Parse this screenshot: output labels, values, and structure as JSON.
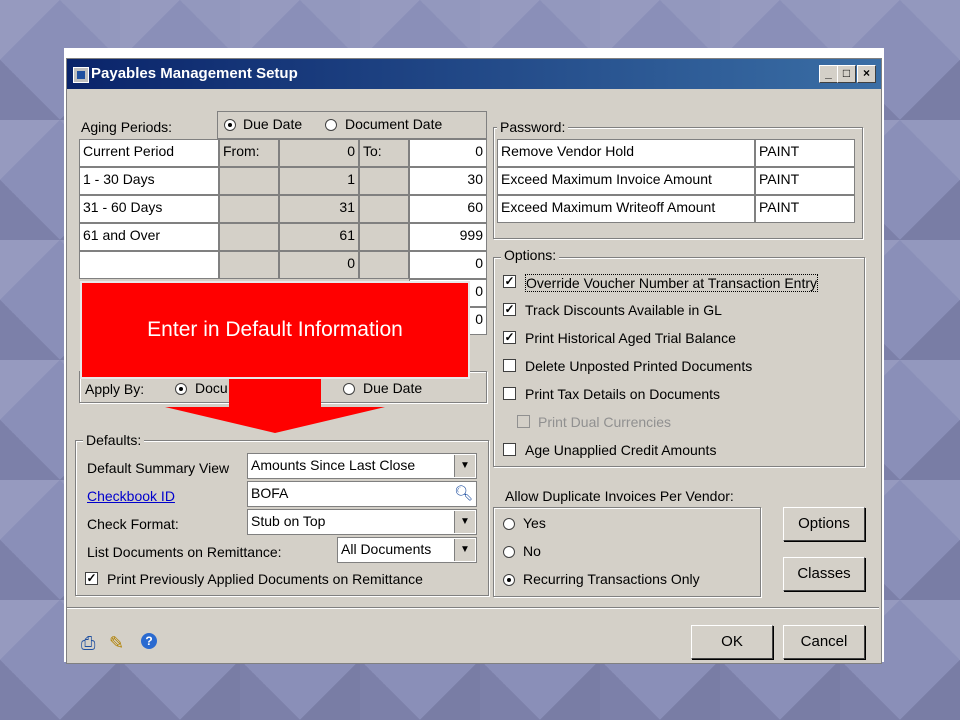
{
  "window": {
    "title": "Payables Management Setup"
  },
  "aging": {
    "label": "Aging Periods:",
    "radio_due_date": "Due Date",
    "radio_document_date": "Document Date",
    "from_label": "From:",
    "to_label": "To:",
    "rows": [
      {
        "name": "Current Period",
        "from": "0",
        "to": "0"
      },
      {
        "name": "1 - 30 Days",
        "from": "1",
        "to": "30"
      },
      {
        "name": "31 - 60 Days",
        "from": "31",
        "to": "60"
      },
      {
        "name": "61 and Over",
        "from": "61",
        "to": "999"
      },
      {
        "name": "",
        "from": "0",
        "to": "0"
      },
      {
        "name": "",
        "from": "",
        "to": "0"
      },
      {
        "name": "",
        "from": "",
        "to": "0"
      }
    ],
    "apply_by_label": "Apply By:",
    "apply_by_doc": "Docu",
    "apply_by_due": "Due Date"
  },
  "callout": {
    "text": "Enter in Default Information"
  },
  "password": {
    "title": "Password:",
    "rows": [
      {
        "label": "Remove Vendor Hold",
        "value": "PAINT"
      },
      {
        "label": "Exceed Maximum Invoice Amount",
        "value": "PAINT"
      },
      {
        "label": "Exceed Maximum Writeoff Amount",
        "value": "PAINT"
      }
    ]
  },
  "options": {
    "title": "Options:",
    "items": [
      {
        "label": "Override Voucher Number at Transaction Entry",
        "checked": true
      },
      {
        "label": "Track Discounts  Available in GL",
        "checked": true
      },
      {
        "label": "Print Historical  Aged Trial Balance",
        "checked": true
      },
      {
        "label": "Delete Unposted Printed Documents",
        "checked": false
      },
      {
        "label": "Print Tax Details on Documents",
        "checked": false
      },
      {
        "label": "Print Dual Currencies",
        "checked": false
      },
      {
        "label": "Age Unapplied Credit Amounts",
        "checked": false
      }
    ]
  },
  "defaults": {
    "title": "Defaults:",
    "summary_view_label": "Default Summary View",
    "summary_view_value": "Amounts Since Last Close",
    "checkbook_label": "Checkbook ID",
    "checkbook_value": "BOFA",
    "check_format_label": "Check Format:",
    "check_format_value": "Stub on Top",
    "list_docs_label": "List Documents on Remittance:",
    "list_docs_value": "All Documents",
    "print_prev_label": "Print Previously Applied Documents on Remittance"
  },
  "duplicates": {
    "label": "Allow Duplicate Invoices Per Vendor:",
    "yes": "Yes",
    "no": "No",
    "recurring": "Recurring Transactions Only"
  },
  "buttons": {
    "options": "Options",
    "classes": "Classes",
    "ok": "OK",
    "cancel": "Cancel"
  }
}
